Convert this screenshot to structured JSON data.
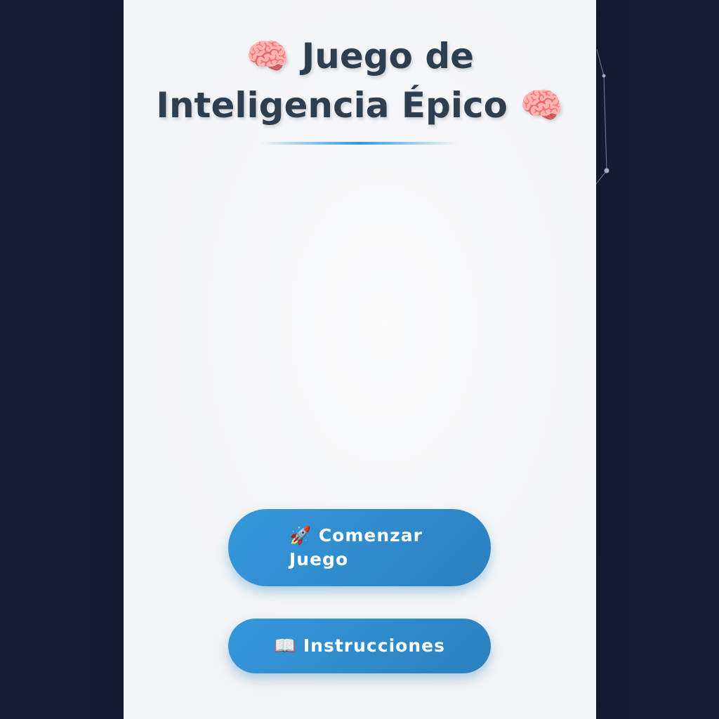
{
  "title": {
    "emoji_left": "🧠",
    "line1": "Juego de",
    "line2": "Inteligencia Épico",
    "emoji_right": "🧠"
  },
  "buttons": {
    "start_label": "🚀 Comenzar Juego",
    "instructions_label": "📖 Instrucciones"
  },
  "colors": {
    "background": "#191c38",
    "panel": "#f2f3f5",
    "title": "#2c3e50",
    "accent": "#3498db"
  }
}
